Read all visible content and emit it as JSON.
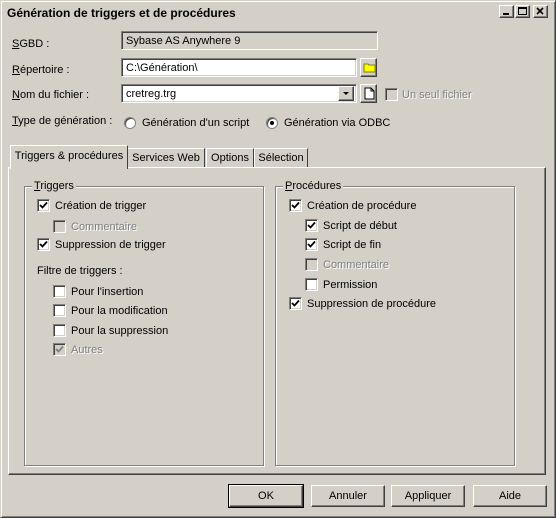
{
  "window": {
    "title": "Génération de triggers et de procédures",
    "controls": [
      "minimize",
      "maximize",
      "close"
    ]
  },
  "form": {
    "sgbd_label": "SGBD :",
    "sgbd_value": "Sybase AS Anywhere 9",
    "repertoire_label": "Répertoire :",
    "repertoire_value": "C:\\Génération\\",
    "fichier_label": "Nom du fichier :",
    "fichier_value": "cretreg.trg",
    "un_seul_fichier_label": "Un seul fichier",
    "un_seul_fichier_checked": false,
    "type_label": "Type de génération :",
    "radio_script_label": "Génération d'un script",
    "radio_odbc_label": "Génération via ODBC",
    "selected_type": "odbc"
  },
  "tabs": [
    {
      "label": "Triggers & procédures",
      "active": true
    },
    {
      "label": "Services Web",
      "active": false
    },
    {
      "label": "Options",
      "active": false
    },
    {
      "label": "Sélection",
      "active": false
    }
  ],
  "triggers": {
    "group_label": "Triggers",
    "creation_label": "Création de trigger",
    "creation_checked": true,
    "commentaire_label": "Commentaire",
    "commentaire_checked": false,
    "suppression_label": "Suppression de trigger",
    "suppression_checked": true,
    "filtre_label": "Filtre de triggers :",
    "insertion_label": "Pour l'insertion",
    "insertion_checked": false,
    "modification_label": "Pour la modification",
    "modification_checked": false,
    "suppression_filtre_label": "Pour la suppression",
    "suppression_filtre_checked": false,
    "autres_label": "Autres",
    "autres_checked": true
  },
  "procedures": {
    "group_label": "Procédures",
    "creation_label": "Création de procédure",
    "creation_checked": true,
    "script_debut_label": "Script de début",
    "script_debut_checked": true,
    "script_fin_label": "Script de fin",
    "script_fin_checked": true,
    "commentaire_label": "Commentaire",
    "commentaire_checked": false,
    "permission_label": "Permission",
    "permission_checked": false,
    "suppression_label": "Suppression de procédure",
    "suppression_checked": true
  },
  "buttons": {
    "ok": "OK",
    "annuler": "Annuler",
    "appliquer": "Appliquer",
    "aide": "Aide"
  }
}
